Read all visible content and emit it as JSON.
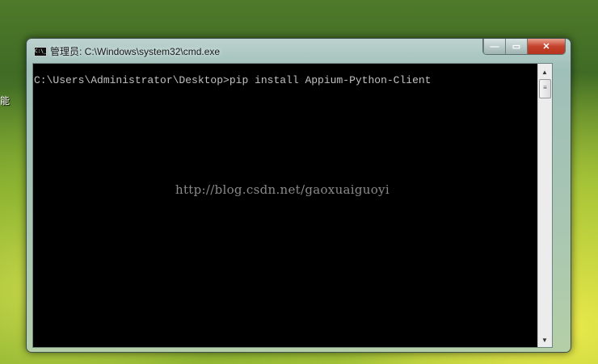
{
  "desktop": {
    "icon_label_fragment": "能"
  },
  "window": {
    "title": "管理员: C:\\Windows\\system32\\cmd.exe",
    "icon_text": "C:\\_",
    "controls": {
      "minimize": "—",
      "maximize": "▭",
      "close": "✕"
    }
  },
  "console": {
    "lines": [
      "C:\\Users\\Administrator\\Desktop>pip install Appium-Python-Client"
    ],
    "watermark": "http://blog.csdn.net/gaoxuaiguoyi"
  },
  "scrollbar": {
    "up": "▲",
    "thumb": "≡",
    "down": "▼"
  }
}
